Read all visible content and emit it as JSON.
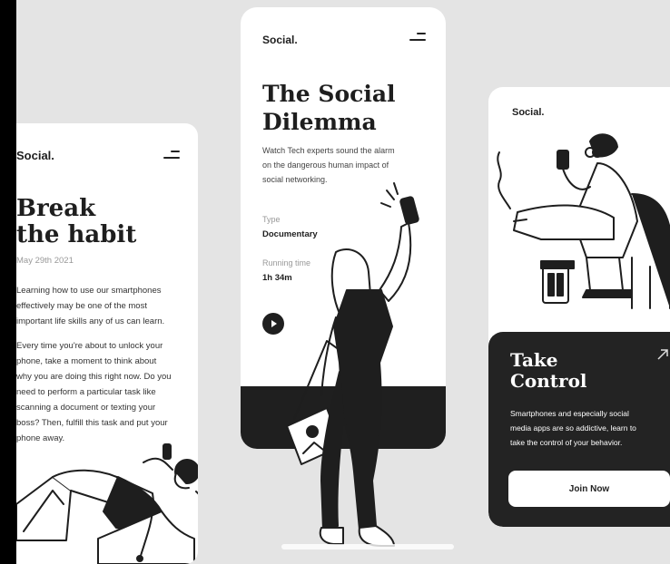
{
  "brand": "Social.",
  "left_card": {
    "brand": "Social.",
    "title_line1": "Break",
    "title_line2": "the habit",
    "date": "May 29th 2021",
    "paragraph1": [
      "Learning how to use our smartphones",
      "effectively may be one of the most",
      "important life skills any of us can learn."
    ],
    "paragraph2": [
      "Every time you're about to unlock your",
      "phone, take a moment to think about",
      "why you are doing this right now. Do you",
      "need to perform a particular task like",
      "scanning a document or texting your",
      "boss? Then, fulfill this task and put your",
      "phone away."
    ]
  },
  "mid_card": {
    "brand": "Social.",
    "title_line1": "The Social",
    "title_line2": "Dilemma",
    "description": [
      "Watch Tech experts sound the alarm",
      "on the dangerous human impact of",
      "social networking."
    ],
    "type_label": "Type",
    "type_value": "Documentary",
    "runtime_label": "Running time",
    "runtime_value": "1h 34m"
  },
  "right_card": {
    "brand": "Social.",
    "title_line1": "Take",
    "title_line2": "Control",
    "description": [
      "Smartphones and especially social",
      "media apps are so addictive, learn to",
      "take the control of your behavior."
    ],
    "button_label": "Join Now"
  },
  "colors": {
    "background": "#e4e4e4",
    "card": "#ffffff",
    "dark": "#1f1f1f",
    "muted_text": "#999999"
  },
  "icons": [
    "menu-icon",
    "play-icon",
    "arrow-up-right-icon"
  ]
}
